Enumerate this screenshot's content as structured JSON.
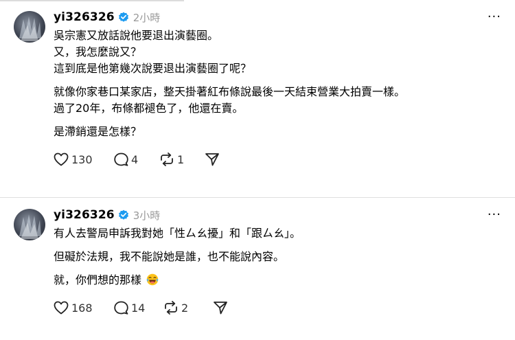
{
  "posts": [
    {
      "username": "yi326326",
      "time": "2小時",
      "more": "···",
      "lines": [
        "吳宗憲又放話說他要退出演藝圈。",
        "又，我怎麼說又？",
        "這到底是他第幾次說要退出演藝圈了呢？",
        "就像你家巷口某家店，整天掛著紅布條說最後一天結束營業大拍賣一樣。",
        "過了20年，布條都褪色了，他還在賣。",
        "是滯銷還是怎樣？"
      ],
      "likes": "130",
      "comments": "4",
      "reposts": "1"
    },
    {
      "username": "yi326326",
      "time": "3小時",
      "more": "···",
      "lines": [
        "有人去警局申訴我對她「性ㄙㄠ擾」和「跟ㄙㄠ」。",
        "但礙於法規，我不能說她是誰，也不能說內容。",
        "就，你們想的那樣"
      ],
      "likes": "168",
      "comments": "14",
      "reposts": "2"
    }
  ],
  "icons": {
    "verified": "verified-badge-icon",
    "like": "heart-icon",
    "comment": "speech-bubble-icon",
    "repost": "repost-icon",
    "share": "send-icon",
    "emoji": "laughing-tears-emoji-icon"
  },
  "colors": {
    "verified": "#1d9bf0",
    "muted": "#999999",
    "divider": "#dedede"
  }
}
